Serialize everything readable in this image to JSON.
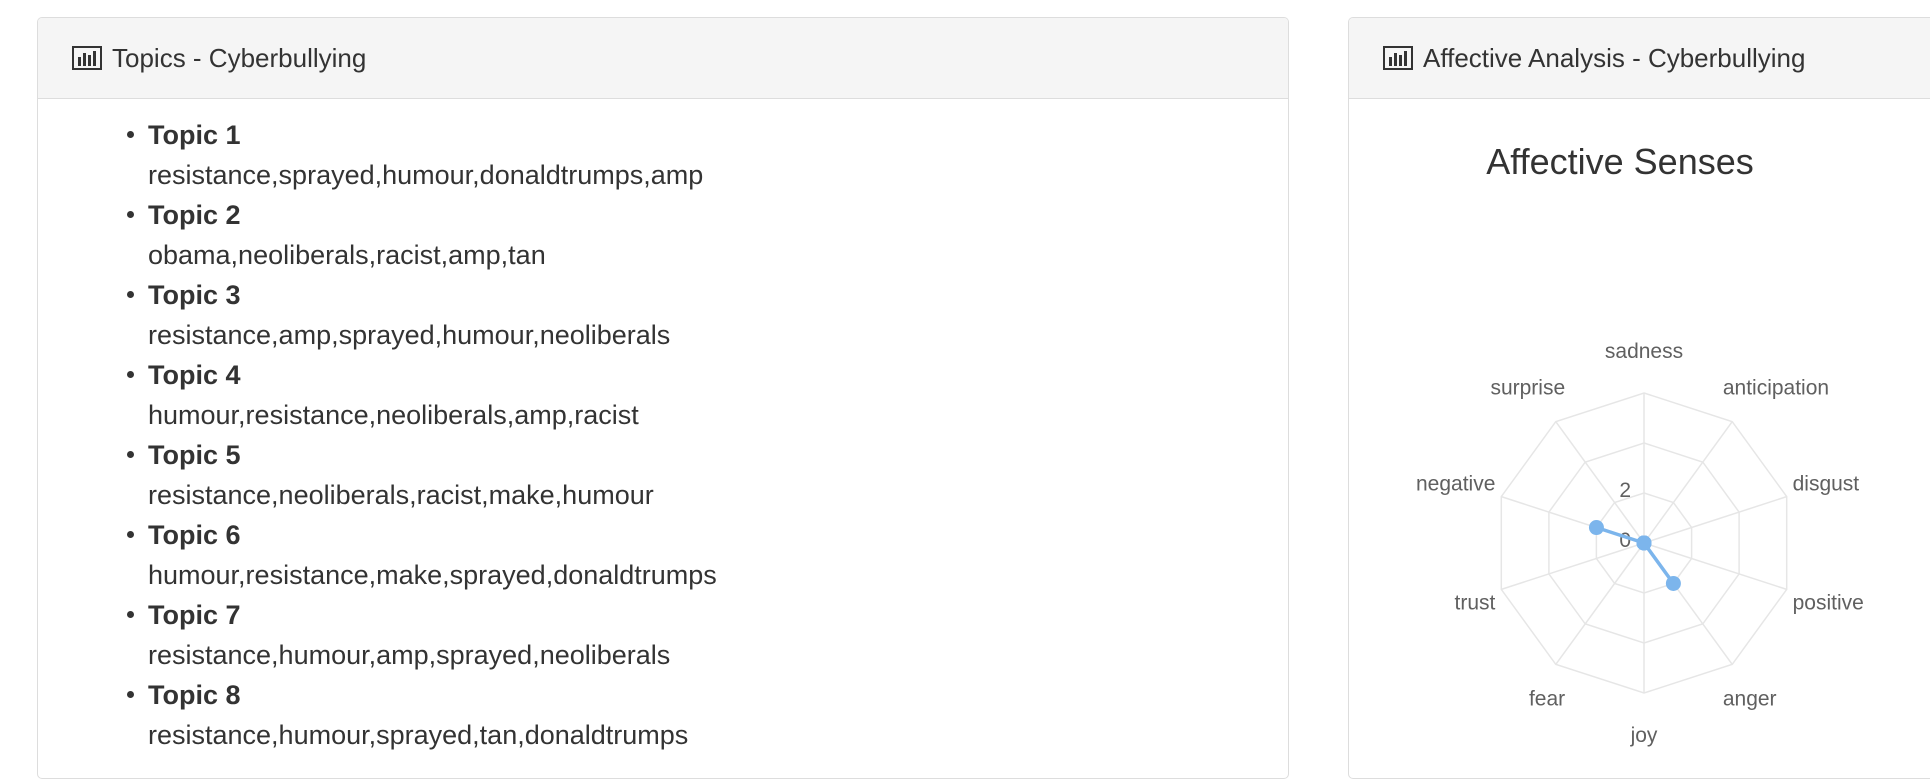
{
  "topics_panel": {
    "title": "Topics - Cyberbullying",
    "icon": "bar-chart-icon",
    "topics": [
      {
        "label": "Topic 1",
        "words": "resistance,sprayed,humour,donaldtrumps,amp"
      },
      {
        "label": "Topic 2",
        "words": "obama,neoliberals,racist,amp,tan"
      },
      {
        "label": "Topic 3",
        "words": "resistance,amp,sprayed,humour,neoliberals"
      },
      {
        "label": "Topic 4",
        "words": "humour,resistance,neoliberals,amp,racist"
      },
      {
        "label": "Topic 5",
        "words": "resistance,neoliberals,racist,make,humour"
      },
      {
        "label": "Topic 6",
        "words": "humour,resistance,make,sprayed,donaldtrumps"
      },
      {
        "label": "Topic 7",
        "words": "resistance,humour,amp,sprayed,neoliberals"
      },
      {
        "label": "Topic 8",
        "words": "resistance,humour,sprayed,tan,donaldtrumps"
      }
    ]
  },
  "affect_panel": {
    "title": "Affective Analysis - Cyberbullying",
    "icon": "bar-chart-icon"
  },
  "chart_data": {
    "type": "radar",
    "title": "Affective Senses",
    "categories": [
      "sadness",
      "anticipation",
      "disgust",
      "positive",
      "anger",
      "joy",
      "fear",
      "trust",
      "negative",
      "surprise"
    ],
    "values": [
      0,
      0,
      0,
      0,
      2,
      0,
      0,
      0,
      2,
      0
    ],
    "ticks": [
      "0",
      "2"
    ],
    "rmax": 6,
    "grid": true,
    "series_color": "#7cb5ec"
  }
}
